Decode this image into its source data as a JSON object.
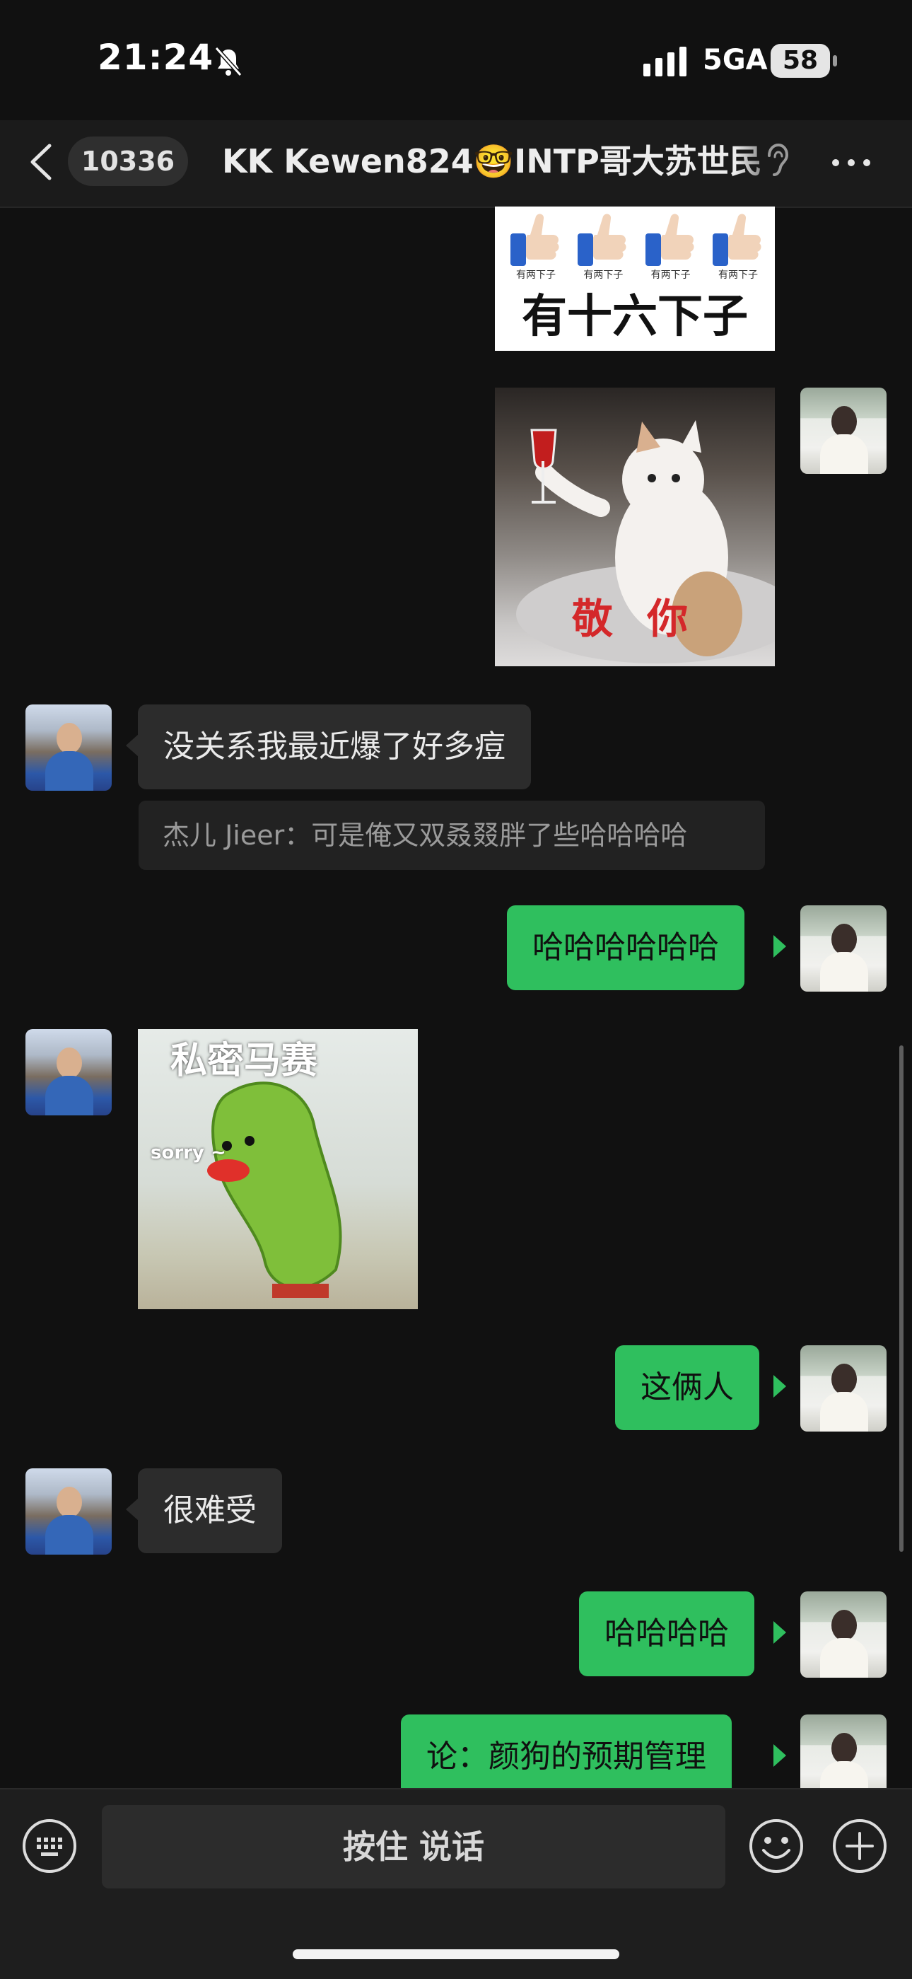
{
  "status_bar": {
    "time": "21:24",
    "network": "5GA",
    "battery": "58",
    "icons": [
      "bell-muted-icon",
      "signal-bars-icon"
    ]
  },
  "nav": {
    "back_icon": "chevron-left-icon",
    "unread_count": "10336",
    "title": "KK Kewen824🤓INTP哥大苏世民",
    "title_suffix_icon": "ear-icon",
    "more_icon": "more-horizontal-icon"
  },
  "messages": [
    {
      "side": "sent",
      "type": "sticker",
      "caption": "有十六下子",
      "sub_captions": [
        "有两下子",
        "有两下子",
        "有两下子",
        "有两下子"
      ]
    },
    {
      "side": "sent",
      "type": "sticker",
      "caption": "敬 你"
    },
    {
      "side": "received",
      "type": "text",
      "text": "没关系我最近爆了好多痘"
    },
    {
      "side": "received",
      "type": "quote",
      "text": "杰儿 Jieer：可是俺又双叒叕胖了些哈哈哈哈"
    },
    {
      "side": "sent",
      "type": "text",
      "text": "哈哈哈哈哈哈"
    },
    {
      "side": "received",
      "type": "sticker",
      "caption": "私密马赛",
      "sub_caption": "sorry ~"
    },
    {
      "side": "sent",
      "type": "text",
      "text": "这俩人"
    },
    {
      "side": "received",
      "type": "text",
      "text": "很难受"
    },
    {
      "side": "sent",
      "type": "text",
      "text": "哈哈哈哈"
    },
    {
      "side": "sent",
      "type": "text",
      "text": "论：颜狗的预期管理"
    }
  ],
  "input_bar": {
    "keyboard_icon": "keyboard-icon",
    "hold_to_talk": "按住 说话",
    "emoji_icon": "emoji-icon",
    "plus_icon": "plus-icon"
  },
  "colors": {
    "background": "#111111",
    "sent_bubble": "#2fbf5e",
    "received_bubble": "#2c2c2c",
    "nav_bar": "#1b1b1b"
  }
}
